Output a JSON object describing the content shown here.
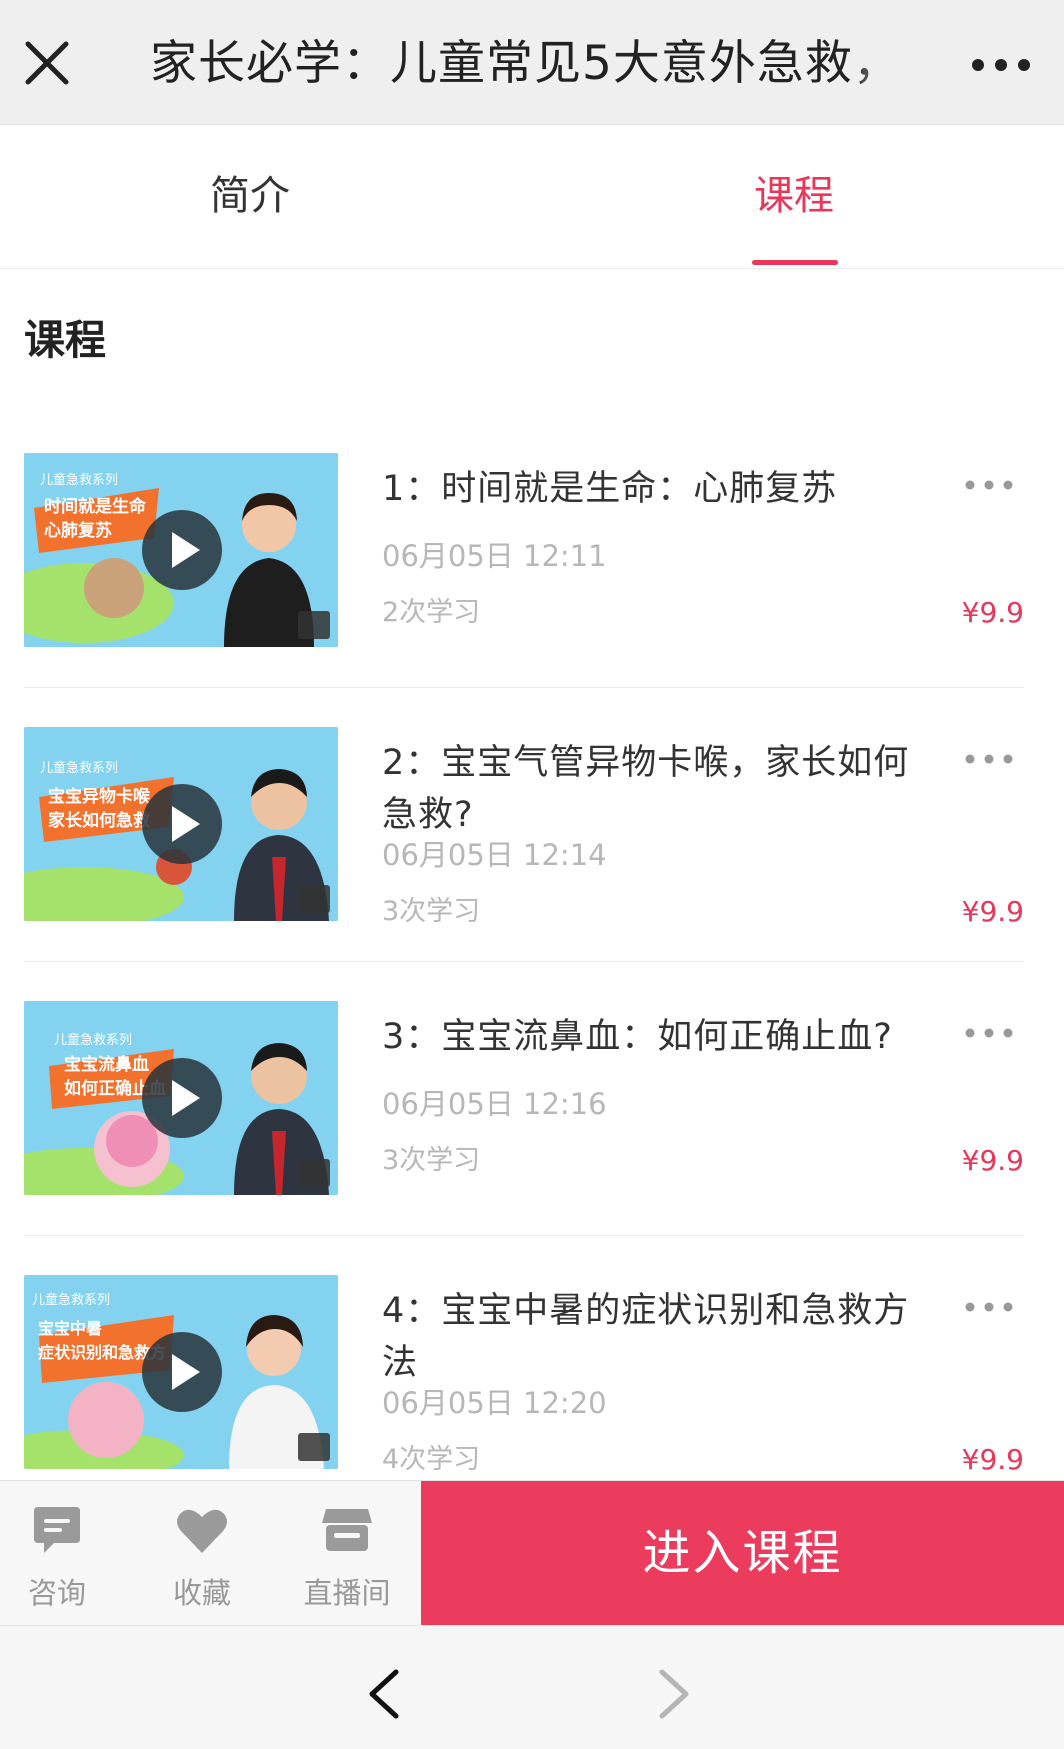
{
  "header": {
    "title": "家长必学：儿童常见5大意外急救，",
    "close_icon": "close-icon",
    "more_icon": "more-dots-icon"
  },
  "tabs": [
    {
      "label": "简介",
      "active": false
    },
    {
      "label": "课程",
      "active": true
    }
  ],
  "section_title": "课程",
  "courses": [
    {
      "title": "1：时间就是生命：心肺复苏",
      "date": "06月05日 12:11",
      "count": "2次学习",
      "price": "¥9.9",
      "thumb_text": [
        "时间就是生命",
        "心肺复苏"
      ]
    },
    {
      "title": "2：宝宝气管异物卡喉，家长如何急救?",
      "date": "06月05日 12:14",
      "count": "3次学习",
      "price": "¥9.9",
      "thumb_text": [
        "宝宝异物卡喉",
        "家长如何急救"
      ]
    },
    {
      "title": "3：宝宝流鼻血：如何正确止血?",
      "date": "06月05日 12:16",
      "count": "3次学习",
      "price": "¥9.9",
      "thumb_text": [
        "宝宝流鼻血",
        "如何正确止血"
      ]
    },
    {
      "title": "4：宝宝中暑的症状识别和急救方法",
      "date": "06月05日 12:20",
      "count": "4次学习",
      "price": "¥9.9",
      "thumb_text": [
        "宝宝中暑",
        "症状识别和急救方"
      ]
    }
  ],
  "bottom_bar": {
    "consult": "咨询",
    "favorite": "收藏",
    "live": "直播间",
    "enter": "进入课程"
  },
  "colors": {
    "accent": "#e8375a",
    "button": "#eb3c5e",
    "thumb_bg": "#7fd0ee"
  }
}
